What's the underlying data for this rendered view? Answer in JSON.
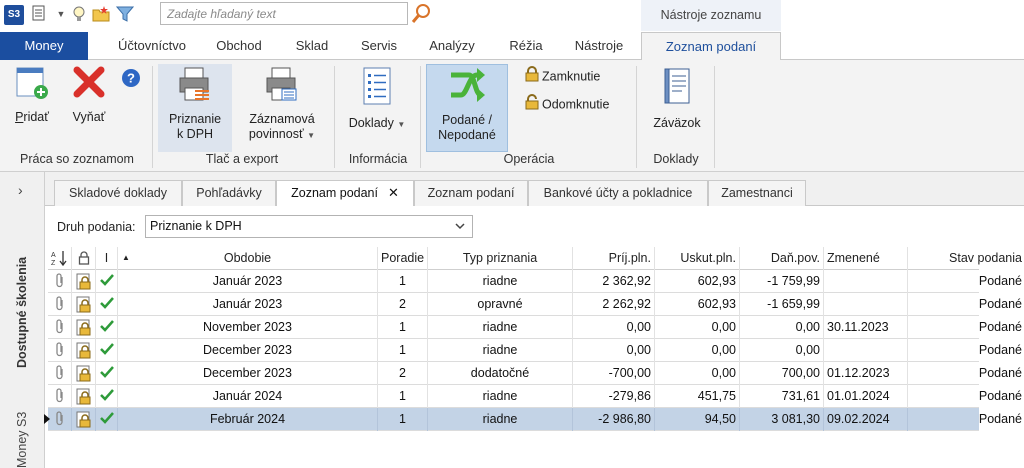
{
  "titlebar": {
    "logo": "S3",
    "search_placeholder": "Zadajte hľadaný text",
    "context_title": "Nástroje zoznamu"
  },
  "ribbon_tabs": [
    "Money",
    "Účtovníctvo",
    "Obchod",
    "Sklad",
    "Servis",
    "Analýzy",
    "Réžia",
    "Nástroje",
    "Zoznam podaní"
  ],
  "ribbon": {
    "add_label": "Pridať",
    "add_underline": "P",
    "add_rest": "ridať",
    "remove_label": "Vyňať",
    "group_list_ops": "Práca so zoznamom",
    "vat_return_line1": "Priznanie",
    "vat_return_line2": "k DPH",
    "summary_line1": "Záznamová",
    "summary_line2": "povinnosť",
    "group_print": "Tlač a export",
    "documents_label": "Doklady",
    "group_info": "Informácia",
    "submitted_line1": "Podané /",
    "submitted_line2": "Nepodané",
    "lock_label": "Zamknutie",
    "unlock_label": "Odomknutie",
    "group_operation": "Operácia",
    "liability_label": "Záväzok",
    "group_documents": "Doklady"
  },
  "siderail": {
    "training": "Dostupné školenia",
    "money": "Money S3"
  },
  "doc_tabs": [
    "Skladové doklady",
    "Pohľadávky",
    "Zoznam podaní",
    "Zoznam podaní",
    "Bankové účty a pokladnice",
    "Zamestnanci"
  ],
  "filter": {
    "label": "Druh podania:",
    "value": "Priznanie k DPH"
  },
  "grid": {
    "columns": [
      "",
      "",
      "I",
      "Obdobie",
      "Poradie",
      "Typ priznania",
      "Príj.pln.",
      "Uskut.pln.",
      "Daň.pov.",
      "Zmenené",
      "Stav podania"
    ],
    "rows": [
      {
        "period": "Január 2023",
        "order": "1",
        "type": "riadne",
        "received": "2 362,92",
        "performed": "602,93",
        "tax": "-1 759,99",
        "changed": "",
        "status": "Podané"
      },
      {
        "period": "Január 2023",
        "order": "2",
        "type": "opravné",
        "received": "2 262,92",
        "performed": "602,93",
        "tax": "-1 659,99",
        "changed": "",
        "status": "Podané"
      },
      {
        "period": "November 2023",
        "order": "1",
        "type": "riadne",
        "received": "0,00",
        "performed": "0,00",
        "tax": "0,00",
        "changed": "30.11.2023",
        "status": "Podané"
      },
      {
        "period": "December 2023",
        "order": "1",
        "type": "riadne",
        "received": "0,00",
        "performed": "0,00",
        "tax": "0,00",
        "changed": "",
        "status": "Podané"
      },
      {
        "period": "December 2023",
        "order": "2",
        "type": "dodatočné",
        "received": "-700,00",
        "performed": "0,00",
        "tax": "700,00",
        "changed": "01.12.2023",
        "status": "Podané"
      },
      {
        "period": "Január 2024",
        "order": "1",
        "type": "riadne",
        "received": "-279,86",
        "performed": "451,75",
        "tax": "731,61",
        "changed": "01.01.2024",
        "status": "Podané"
      },
      {
        "period": "Február 2024",
        "order": "1",
        "type": "riadne",
        "received": "-2 986,80",
        "performed": "94,50",
        "tax": "3 081,30",
        "changed": "09.02.2024",
        "status": "Podané"
      }
    ]
  },
  "colors": {
    "brand_blue": "#1b4ea0",
    "selected_row": "#c3d3e6",
    "check_green": "#2e9b3a",
    "remove_red": "#d9302a"
  },
  "icons": [
    "app-logo-icon",
    "document-menu-icon",
    "lightbulb-icon",
    "folder-star-icon",
    "filter-icon",
    "search-icon",
    "add-document-icon",
    "remove-x-icon",
    "help-icon",
    "printer-form-icon",
    "printer-list-icon",
    "documents-list-icon",
    "swap-arrows-icon",
    "lock-icon",
    "unlock-icon",
    "ledger-book-icon",
    "attachment-icon",
    "lock-doc-icon",
    "check-icon",
    "chevron-down-icon",
    "close-icon"
  ]
}
